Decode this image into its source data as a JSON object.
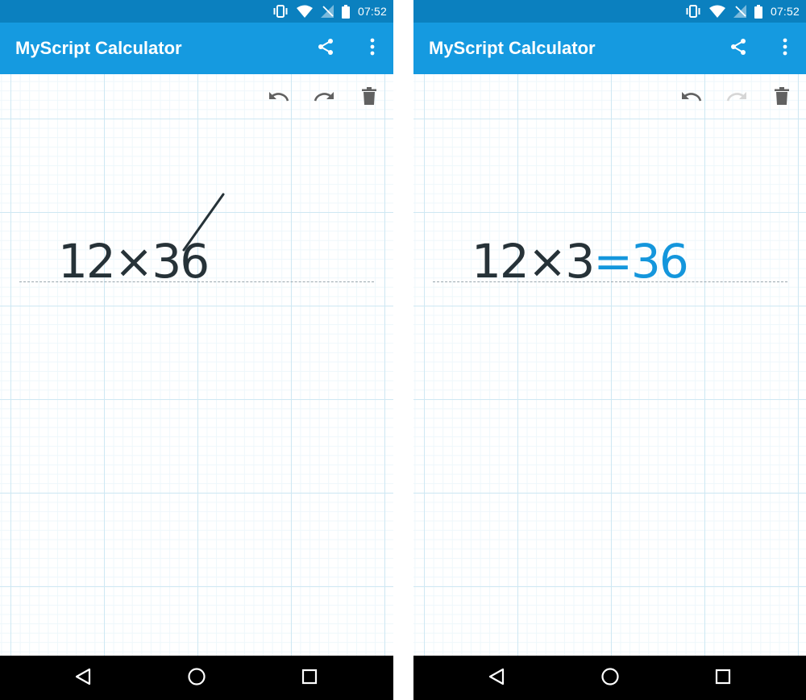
{
  "status_bar": {
    "time": "07:52"
  },
  "app": {
    "title": "MyScript Calculator",
    "icons": {
      "share": "share-icon",
      "menu": "more-vertical-icon",
      "undo": "undo-icon",
      "redo": "redo-icon",
      "clear": "trash-icon"
    }
  },
  "colors": {
    "status_bar": "#0b80bf",
    "app_bar": "#159ae0",
    "ink": "#263238",
    "result": "#1496dc",
    "grid_major": "#cfe8f3",
    "grid_minor": "#eef7fb",
    "nav_bar": "#000000"
  },
  "screens": [
    {
      "expression": "12×36",
      "redo_enabled": true
    },
    {
      "expression": "12×3",
      "equals": "=",
      "result": "36",
      "redo_enabled": false
    }
  ],
  "nav": {
    "back": "back-triangle-icon",
    "home": "home-circle-icon",
    "recents": "recents-square-icon"
  }
}
